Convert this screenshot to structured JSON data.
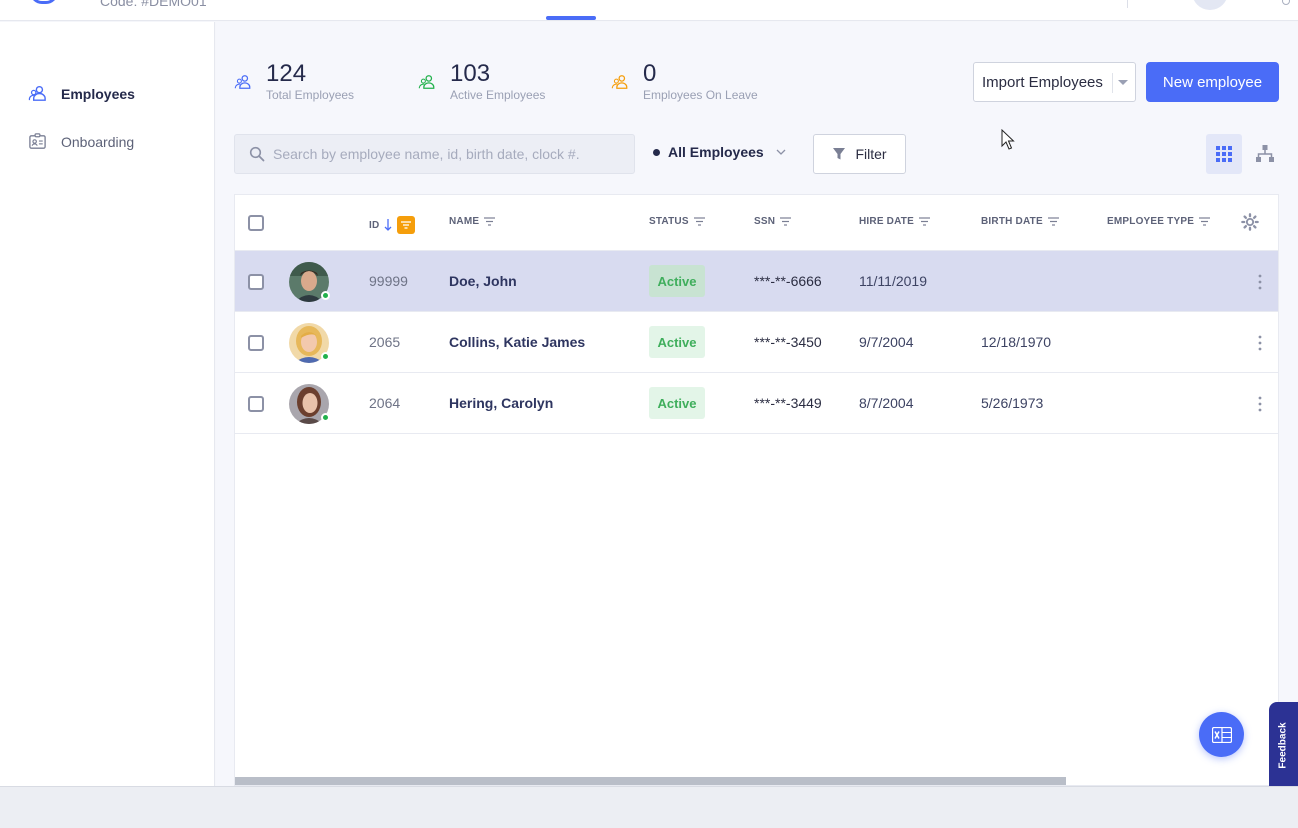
{
  "topbar": {
    "code_text": "Code: #DEMO01"
  },
  "sidebar": {
    "items": [
      {
        "label": "Employees",
        "icon": "employees-icon",
        "active": true
      },
      {
        "label": "Onboarding",
        "icon": "onboarding-icon",
        "active": false
      }
    ]
  },
  "stats": [
    {
      "value": "124",
      "label": "Total Employees",
      "color": "#4a6cf7"
    },
    {
      "value": "103",
      "label": "Active Employees",
      "color": "#22b14c"
    },
    {
      "value": "0",
      "label": "Employees On Leave",
      "color": "#f59e0b"
    }
  ],
  "actions": {
    "import_label": "Import Employees",
    "new_label": "New employee"
  },
  "toolbar": {
    "search_placeholder": "Search by employee name, id, birth date, clock #.",
    "scope_label": "All Employees",
    "filter_label": "Filter"
  },
  "table": {
    "columns": [
      "ID",
      "NAME",
      "STATUS",
      "SSN",
      "HIRE DATE",
      "BIRTH DATE",
      "EMPLOYEE TYPE"
    ],
    "rows": [
      {
        "id": "99999",
        "name": "Doe, John",
        "status": "Active",
        "ssn": "***-**-6666",
        "hire_date": "11/11/2019",
        "birth_date": "",
        "employee_type": "",
        "selected": true
      },
      {
        "id": "2065",
        "name": "Collins, Katie James",
        "status": "Active",
        "ssn": "***-**-3450",
        "hire_date": "9/7/2004",
        "birth_date": "12/18/1970",
        "employee_type": "",
        "selected": false
      },
      {
        "id": "2064",
        "name": "Hering, Carolyn",
        "status": "Active",
        "ssn": "***-**-3449",
        "hire_date": "8/7/2004",
        "birth_date": "5/26/1973",
        "employee_type": "",
        "selected": false
      }
    ]
  },
  "feedback_label": "Feedback",
  "colors": {
    "accent": "#4a6cf7",
    "active_green": "#3fae5c",
    "leave_orange": "#f59e0b",
    "selected_row": "#d8dbf0",
    "feedback_tab": "#2c3294"
  }
}
